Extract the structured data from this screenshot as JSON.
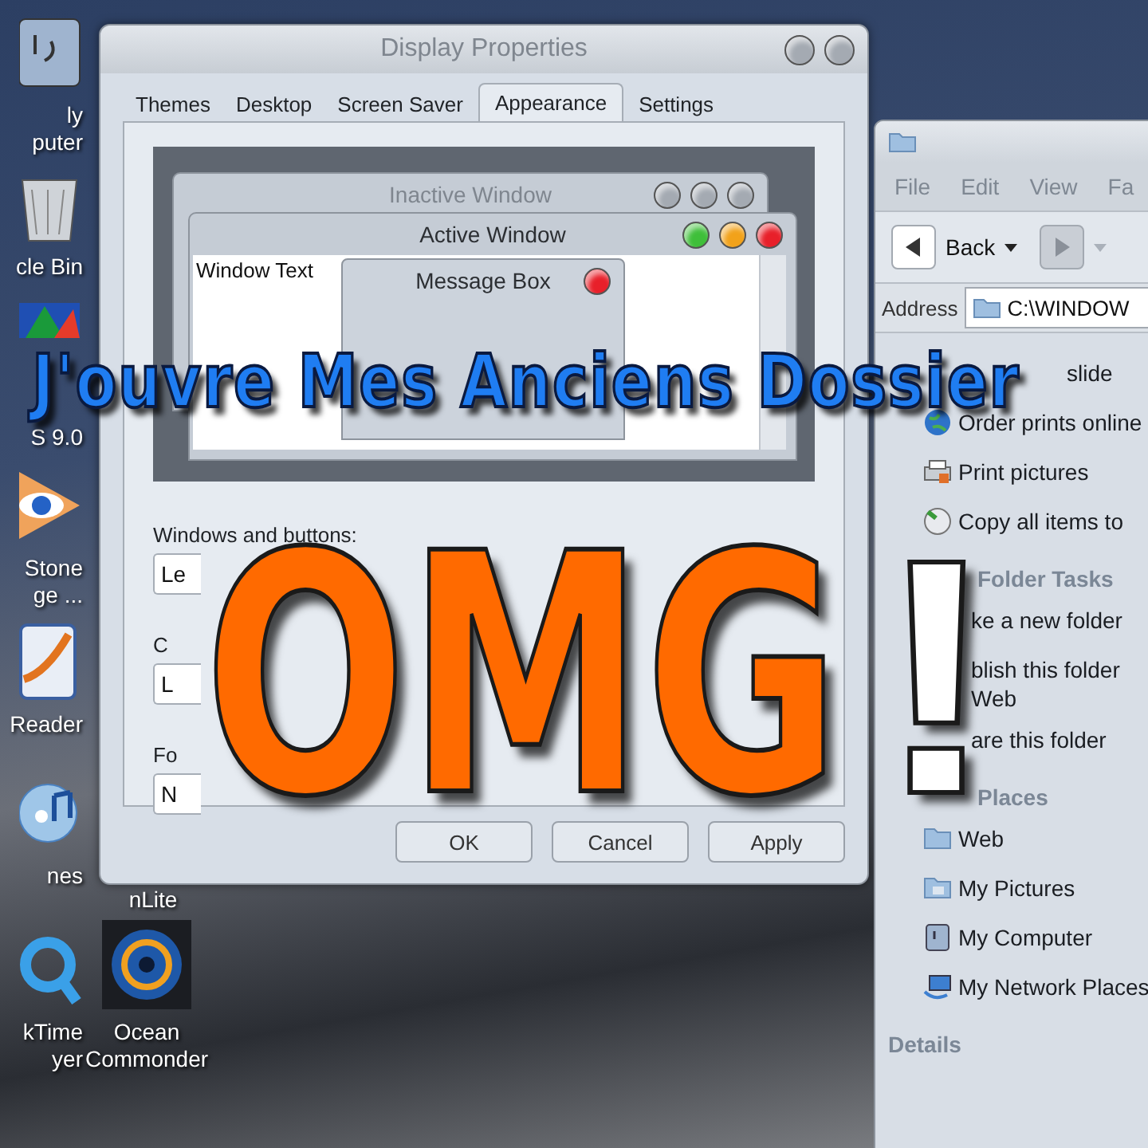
{
  "desktop_icons": [
    {
      "kind": "computer",
      "lines": [
        "ly",
        "puter"
      ]
    },
    {
      "kind": "trash",
      "lines": [
        "cle Bin"
      ]
    },
    {
      "kind": "app",
      "lines": [
        "S 9.0"
      ]
    },
    {
      "kind": "viewer",
      "lines": [
        "Stone",
        "ge ..."
      ]
    },
    {
      "kind": "reader",
      "lines": [
        "Reader"
      ]
    },
    {
      "kind": "music",
      "lines": [
        "nes"
      ]
    },
    {
      "kind": "player",
      "lines": [
        "kTime",
        "yer"
      ]
    },
    {
      "kind": "label",
      "lines": [
        "nLite"
      ]
    },
    {
      "kind": "target",
      "lines": [
        "Ocean",
        "Commonder"
      ]
    }
  ],
  "dialog": {
    "title": "Display Properties",
    "tabs": [
      {
        "label": "Themes",
        "selected": false
      },
      {
        "label": "Desktop",
        "selected": false
      },
      {
        "label": "Screen Saver",
        "selected": false
      },
      {
        "label": "Appearance",
        "selected": true
      },
      {
        "label": "Settings",
        "selected": false
      }
    ],
    "preview": {
      "inactive_title": "Inactive Window",
      "active_title": "Active Window",
      "window_text": "Window Text",
      "message_title": "Message Box"
    },
    "fields": [
      {
        "label": "Windows and buttons:",
        "value": "Le"
      },
      {
        "label": "C",
        "value": "L"
      },
      {
        "label": "Fo",
        "value": "N"
      }
    ],
    "buttons": [
      "OK",
      "Cancel",
      "Apply"
    ]
  },
  "explorer": {
    "menu": [
      "File",
      "Edit",
      "View",
      "Fa"
    ],
    "back": "Back",
    "address_label": "Address",
    "address": "C:\\WINDOW",
    "sections": [
      {
        "items": [
          {
            "text": "slide"
          },
          {
            "text": "Order prints online"
          },
          {
            "text": "Print pictures"
          },
          {
            "text": "Copy all items to"
          }
        ]
      },
      {
        "title": "Folder Tasks",
        "items": [
          {
            "text": "ke a new folder"
          },
          {
            "text": "blish this folder",
            "continuation": "Web"
          },
          {
            "text": "are this folder"
          }
        ]
      },
      {
        "title": "Places",
        "items": [
          {
            "text": "Web"
          },
          {
            "text": "My Pictures"
          },
          {
            "text": "My Computer"
          },
          {
            "text": "My Network Places"
          }
        ]
      },
      {
        "title": "Details"
      }
    ]
  },
  "overlay": {
    "banner": "J'ouvre Mes Anciens Dossier",
    "headline": "OMG",
    "exclaim": "!"
  }
}
